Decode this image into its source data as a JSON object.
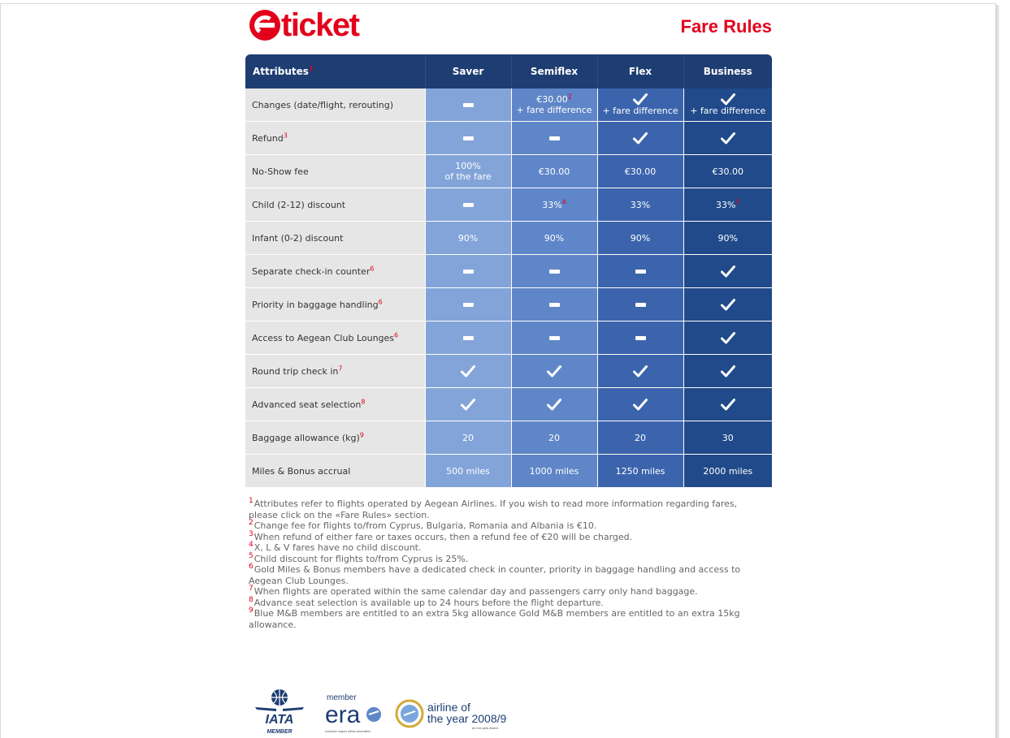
{
  "brand": {
    "logo_text": "ticket",
    "logo_full": "eticket",
    "accent": "#e3001b"
  },
  "page_title": "Fare Rules",
  "table": {
    "header": {
      "attr_label": "Attributes",
      "attr_note": "1"
    },
    "columns": [
      "Saver",
      "Semiflex",
      "Flex",
      "Business"
    ],
    "column_colors": [
      "#83a4d8",
      "#5f86c8",
      "#3c64ad",
      "#204a89"
    ],
    "rows": [
      {
        "label": "Changes (date/flight, rerouting)",
        "note": "",
        "cells": [
          {
            "kind": "dash"
          },
          {
            "kind": "text",
            "text": "€30.00",
            "note": "2",
            "line2": "+ fare difference"
          },
          {
            "kind": "check",
            "line2": "+ fare difference"
          },
          {
            "kind": "check",
            "line2": "+ fare difference"
          }
        ]
      },
      {
        "label": "Refund",
        "note": "3",
        "cells": [
          {
            "kind": "dash"
          },
          {
            "kind": "dash"
          },
          {
            "kind": "check"
          },
          {
            "kind": "check"
          }
        ]
      },
      {
        "label": "No-Show fee",
        "note": "",
        "cells": [
          {
            "kind": "text",
            "text": "100%",
            "line2": "of the fare"
          },
          {
            "kind": "text",
            "text": "€30.00"
          },
          {
            "kind": "text",
            "text": "€30.00"
          },
          {
            "kind": "text",
            "text": "€30.00"
          }
        ]
      },
      {
        "label": "Child (2-12) discount",
        "note": "",
        "cells": [
          {
            "kind": "dash"
          },
          {
            "kind": "text",
            "text": "33%",
            "note": "4"
          },
          {
            "kind": "text",
            "text": "33%"
          },
          {
            "kind": "text",
            "text": "33%",
            "note": "5"
          }
        ]
      },
      {
        "label": "Infant (0-2) discount",
        "note": "",
        "cells": [
          {
            "kind": "text",
            "text": "90%"
          },
          {
            "kind": "text",
            "text": "90%"
          },
          {
            "kind": "text",
            "text": "90%"
          },
          {
            "kind": "text",
            "text": "90%"
          }
        ]
      },
      {
        "label": "Separate check-in counter",
        "note": "6",
        "cells": [
          {
            "kind": "dash"
          },
          {
            "kind": "dash"
          },
          {
            "kind": "dash"
          },
          {
            "kind": "check"
          }
        ]
      },
      {
        "label": "Priority in baggage handling",
        "note": "6",
        "cells": [
          {
            "kind": "dash"
          },
          {
            "kind": "dash"
          },
          {
            "kind": "dash"
          },
          {
            "kind": "check"
          }
        ]
      },
      {
        "label": "Access to Aegean Club Lounges",
        "note": "6",
        "cells": [
          {
            "kind": "dash"
          },
          {
            "kind": "dash"
          },
          {
            "kind": "dash"
          },
          {
            "kind": "check"
          }
        ]
      },
      {
        "label": "Round trip check in",
        "note": "7",
        "cells": [
          {
            "kind": "check"
          },
          {
            "kind": "check"
          },
          {
            "kind": "check"
          },
          {
            "kind": "check"
          }
        ]
      },
      {
        "label": "Advanced seat selection",
        "note": "8",
        "cells": [
          {
            "kind": "check"
          },
          {
            "kind": "check"
          },
          {
            "kind": "check"
          },
          {
            "kind": "check"
          }
        ]
      },
      {
        "label": "Baggage allowance (kg)",
        "note": "9",
        "cells": [
          {
            "kind": "text",
            "text": "20"
          },
          {
            "kind": "text",
            "text": "20"
          },
          {
            "kind": "text",
            "text": "20"
          },
          {
            "kind": "text",
            "text": "30"
          }
        ]
      },
      {
        "label": "Miles & Bonus accrual",
        "note": "",
        "cells": [
          {
            "kind": "text",
            "text": "500 miles"
          },
          {
            "kind": "text",
            "text": "1000 miles"
          },
          {
            "kind": "text",
            "text": "1250 miles"
          },
          {
            "kind": "text",
            "text": "2000 miles"
          }
        ]
      }
    ]
  },
  "footnotes": [
    {
      "num": "1",
      "text": "Attributes refer to flights operated by Aegean Airlines. If you wish to read more information regarding fares, please click on the «Fare Rules» section."
    },
    {
      "num": "2",
      "text": "Change fee for flights to/from Cyprus, Bulgaria, Romania and Albania is €10."
    },
    {
      "num": "3",
      "text": "When refund of either fare or taxes occurs, then a refund fee of €20 will be charged."
    },
    {
      "num": "4",
      "text": "X, L & V fares have no child discount."
    },
    {
      "num": "5",
      "text": "Child discount for flights to/from Cyprus is 25%."
    },
    {
      "num": "6",
      "text": "Gold Miles & Bonus members have a dedicated check in counter, priority in baggage handling and access to Aegean Club Lounges."
    },
    {
      "num": "7",
      "text": "When flights are operated within the same calendar day and passengers carry only hand baggage."
    },
    {
      "num": "8",
      "text": "Advance seat selection is available up to 24 hours before the flight departure."
    },
    {
      "num": "9",
      "text": "Blue M&B members are entitled to an extra 5kg allowance Gold M&B members are entitled to an extra 15kg allowance."
    }
  ],
  "badges": {
    "iata": {
      "name": "IATA",
      "sub": "MEMBER"
    },
    "era": {
      "top": "member",
      "name": "era",
      "sub": "european regions airline association"
    },
    "airline_of_year": {
      "line1": "airline of",
      "line2": "the year 2008/9",
      "sub": "an era gold award"
    }
  }
}
